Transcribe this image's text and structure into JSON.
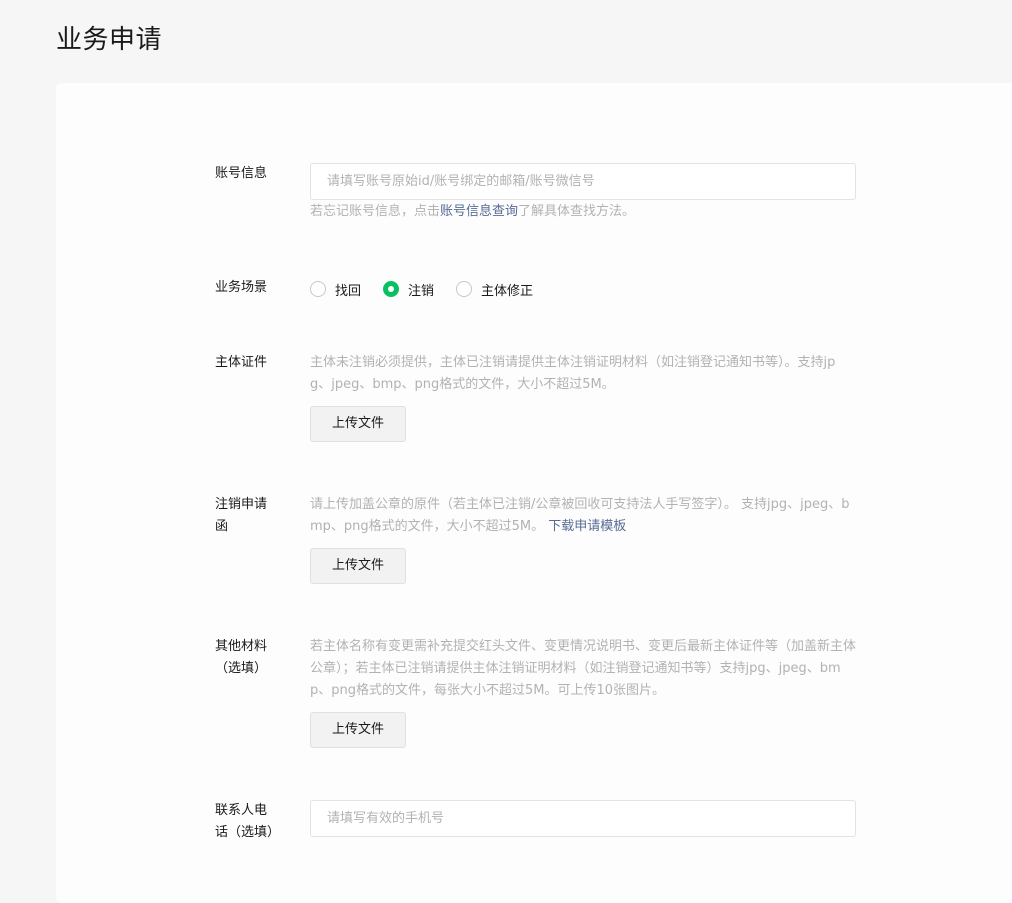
{
  "page": {
    "title": "业务申请"
  },
  "account": {
    "label": "账号信息",
    "placeholder": "请填写账号原始id/账号绑定的邮箱/账号微信号",
    "hint_prefix": "若忘记账号信息，点击",
    "hint_link": "账号信息查询",
    "hint_suffix": "了解具体查找方法。"
  },
  "scene": {
    "label": "业务场景",
    "options": [
      {
        "label": "找回",
        "checked": false
      },
      {
        "label": "注销",
        "checked": true
      },
      {
        "label": "主体修正",
        "checked": false
      }
    ]
  },
  "entity_cert": {
    "label": "主体证件",
    "hint": "主体未注销必须提供，主体已注销请提供主体注销证明材料（如注销登记通知书等）。支持jpg、jpeg、bmp、png格式的文件，大小不超过5M。",
    "upload_label": "上传文件"
  },
  "cancel_letter": {
    "label": "注销申请函",
    "hint": "请上传加盖公章的原件（若主体已注销/公章被回收可支持法人手写签字）。 支持jpg、jpeg、bmp、png格式的文件，大小不超过5M。 ",
    "hint_link": "下载申请模板",
    "upload_label": "上传文件"
  },
  "other_materials": {
    "label": "其他材料（选填）",
    "hint": "若主体名称有变更需补充提交红头文件、变更情况说明书、变更后最新主体证件等（加盖新主体公章）；若主体已注销请提供主体注销证明材料（如注销登记通知书等）支持jpg、jpeg、bmp、png格式的文件，每张大小不超过5M。可上传10张图片。",
    "upload_label": "上传文件"
  },
  "contact_phone": {
    "label": "联系人电话（选填）",
    "placeholder": "请填写有效的手机号"
  }
}
